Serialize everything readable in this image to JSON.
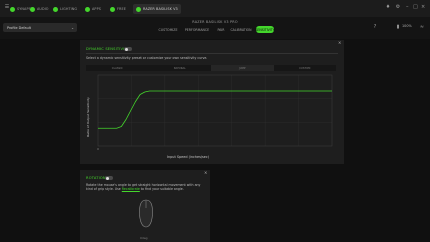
{
  "tabs": [
    {
      "label": "SYNAPSE",
      "active": false
    },
    {
      "label": "AUDIO",
      "active": false
    },
    {
      "label": "LIGHTING",
      "active": false
    },
    {
      "label": "APPS",
      "active": false
    },
    {
      "label": "FREE",
      "active": false
    },
    {
      "label": "RAZER BASILISK V3",
      "active": true
    }
  ],
  "toolbar": {
    "profile": "Profile Default",
    "device_title": "RAZER BASILISK V3 PRO",
    "subtabs": [
      "CUSTOMIZE",
      "PERFORMANCE",
      "PAIR",
      "CALIBRATION",
      "SENSITIVITY"
    ],
    "active_subtab": "SENSITIVITY",
    "battery": "100%"
  },
  "dynamic": {
    "title": "DYNAMIC SENSITIVITY",
    "enabled": false,
    "description": "Select a dynamic sensitivity preset or customize your own sensitivity curve.",
    "presets": [
      "CLASSIC",
      "NATURAL",
      "JUMP",
      "CUSTOM"
    ],
    "selected_preset": "JUMP",
    "chart": {
      "y_title": "Ratio of Output Sensitivity",
      "x_title": "Input Speed (inches/sec)"
    }
  },
  "chart_data": {
    "type": "line",
    "xlabel": "Input Speed (inches/sec)",
    "ylabel": "Ratio of Output Sensitivity",
    "x": [
      0,
      8,
      10,
      12,
      14,
      16,
      18,
      20,
      22,
      25,
      35,
      50,
      75,
      100
    ],
    "series": [
      {
        "values": [
          0.5,
          0.5,
          0.55,
          0.75,
          1.0,
          1.25,
          1.45,
          1.52,
          1.55,
          1.55,
          1.55,
          1.55,
          1.55,
          1.55
        ]
      }
    ],
    "x_ticks": [
      "0",
      "",
      "",
      "",
      "",
      "",
      "",
      ""
    ],
    "y_ticks": [
      "",
      "",
      "",
      ""
    ],
    "grid": true
  },
  "rotation": {
    "title": "ROTATION",
    "enabled": false,
    "description_a": "Rotate the mouse's angle to get straight horizontal movement with any kind of grip",
    "description_b": "style. Use ",
    "link": "Recalibrate",
    "description_c": " to find your suitable angle.",
    "angle_label": "0deg"
  },
  "colors": {
    "accent": "#44d62c",
    "panel": "#1e1e1e",
    "background": "#101010"
  }
}
